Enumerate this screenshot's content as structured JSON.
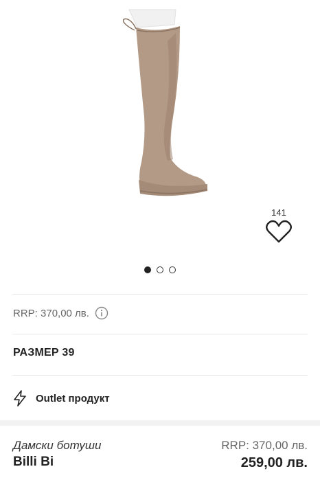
{
  "product": {
    "favorites_count": "141",
    "gallery_dots": 3,
    "gallery_active_index": 0,
    "rrp_label": "RRP: 370,00 лв.",
    "size_label": "РАЗМЕР 39",
    "outlet_label": "Outlet продукт"
  },
  "bottom_bar": {
    "category": "Дамски ботуши",
    "brand": "Billi Bi",
    "rrp": "RRP: 370,00 лв.",
    "price": "259,00 лв."
  },
  "colors": {
    "boot": "#b39a87",
    "boot_shadow": "#9c8270",
    "mannequin": "#f1f1f1"
  },
  "icons": {
    "favorite": "heart-outline-icon",
    "info": "info-circle-icon",
    "outlet": "lightning-bolt-icon"
  }
}
